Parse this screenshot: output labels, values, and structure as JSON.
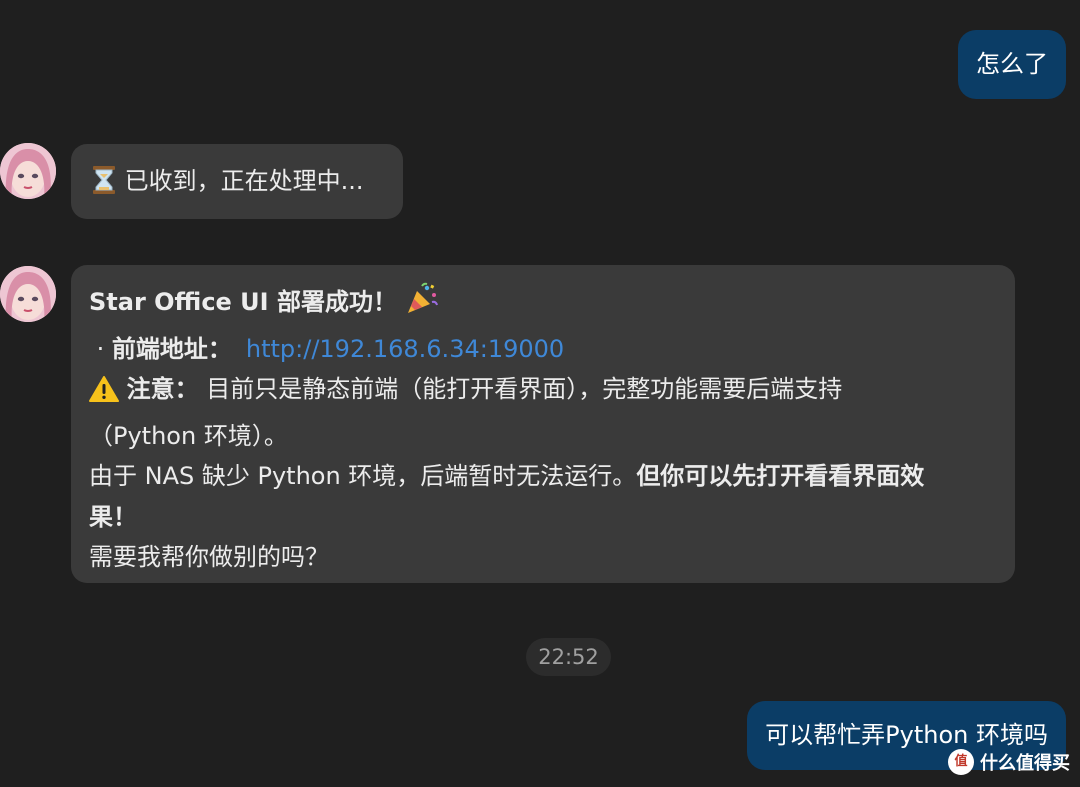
{
  "messages": [
    {
      "id": "msg1",
      "direction": "outgoing",
      "text": "怎么了"
    },
    {
      "id": "msg2",
      "direction": "incoming",
      "icon": "hourglass-icon",
      "text": "已收到，正在处理中..."
    },
    {
      "id": "msg3",
      "direction": "incoming",
      "title": "Star Office UI 部署成功！",
      "title_icon": "party-popper-icon",
      "address_label": "前端地址：",
      "address_url": "http://192.168.6.34:19000",
      "notice_icon": "warning-icon",
      "notice_label": "注意：",
      "notice_line1": "目前只是静态前端（能打开看界面），完整功能需要后端支持",
      "notice_line2": "（Python 环境）。",
      "line3_normal": "由于 NAS 缺少 Python 环境，后端暂时无法运行。",
      "line3_bold": "但你可以先打开看看界面效",
      "line4_bold": "果！",
      "line5": "需要我帮你做别的吗？"
    },
    {
      "id": "msg4",
      "direction": "outgoing",
      "text": "可以帮忙弄Python 环境吗"
    }
  ],
  "timestamp": "22:52",
  "watermark": {
    "badge": "值",
    "text": "什么值得买"
  },
  "colors": {
    "background": "#1f1f1f",
    "outgoing_bubble": "#0b3d66",
    "incoming_bubble": "#3a3a3a",
    "link": "#3f88d7"
  }
}
